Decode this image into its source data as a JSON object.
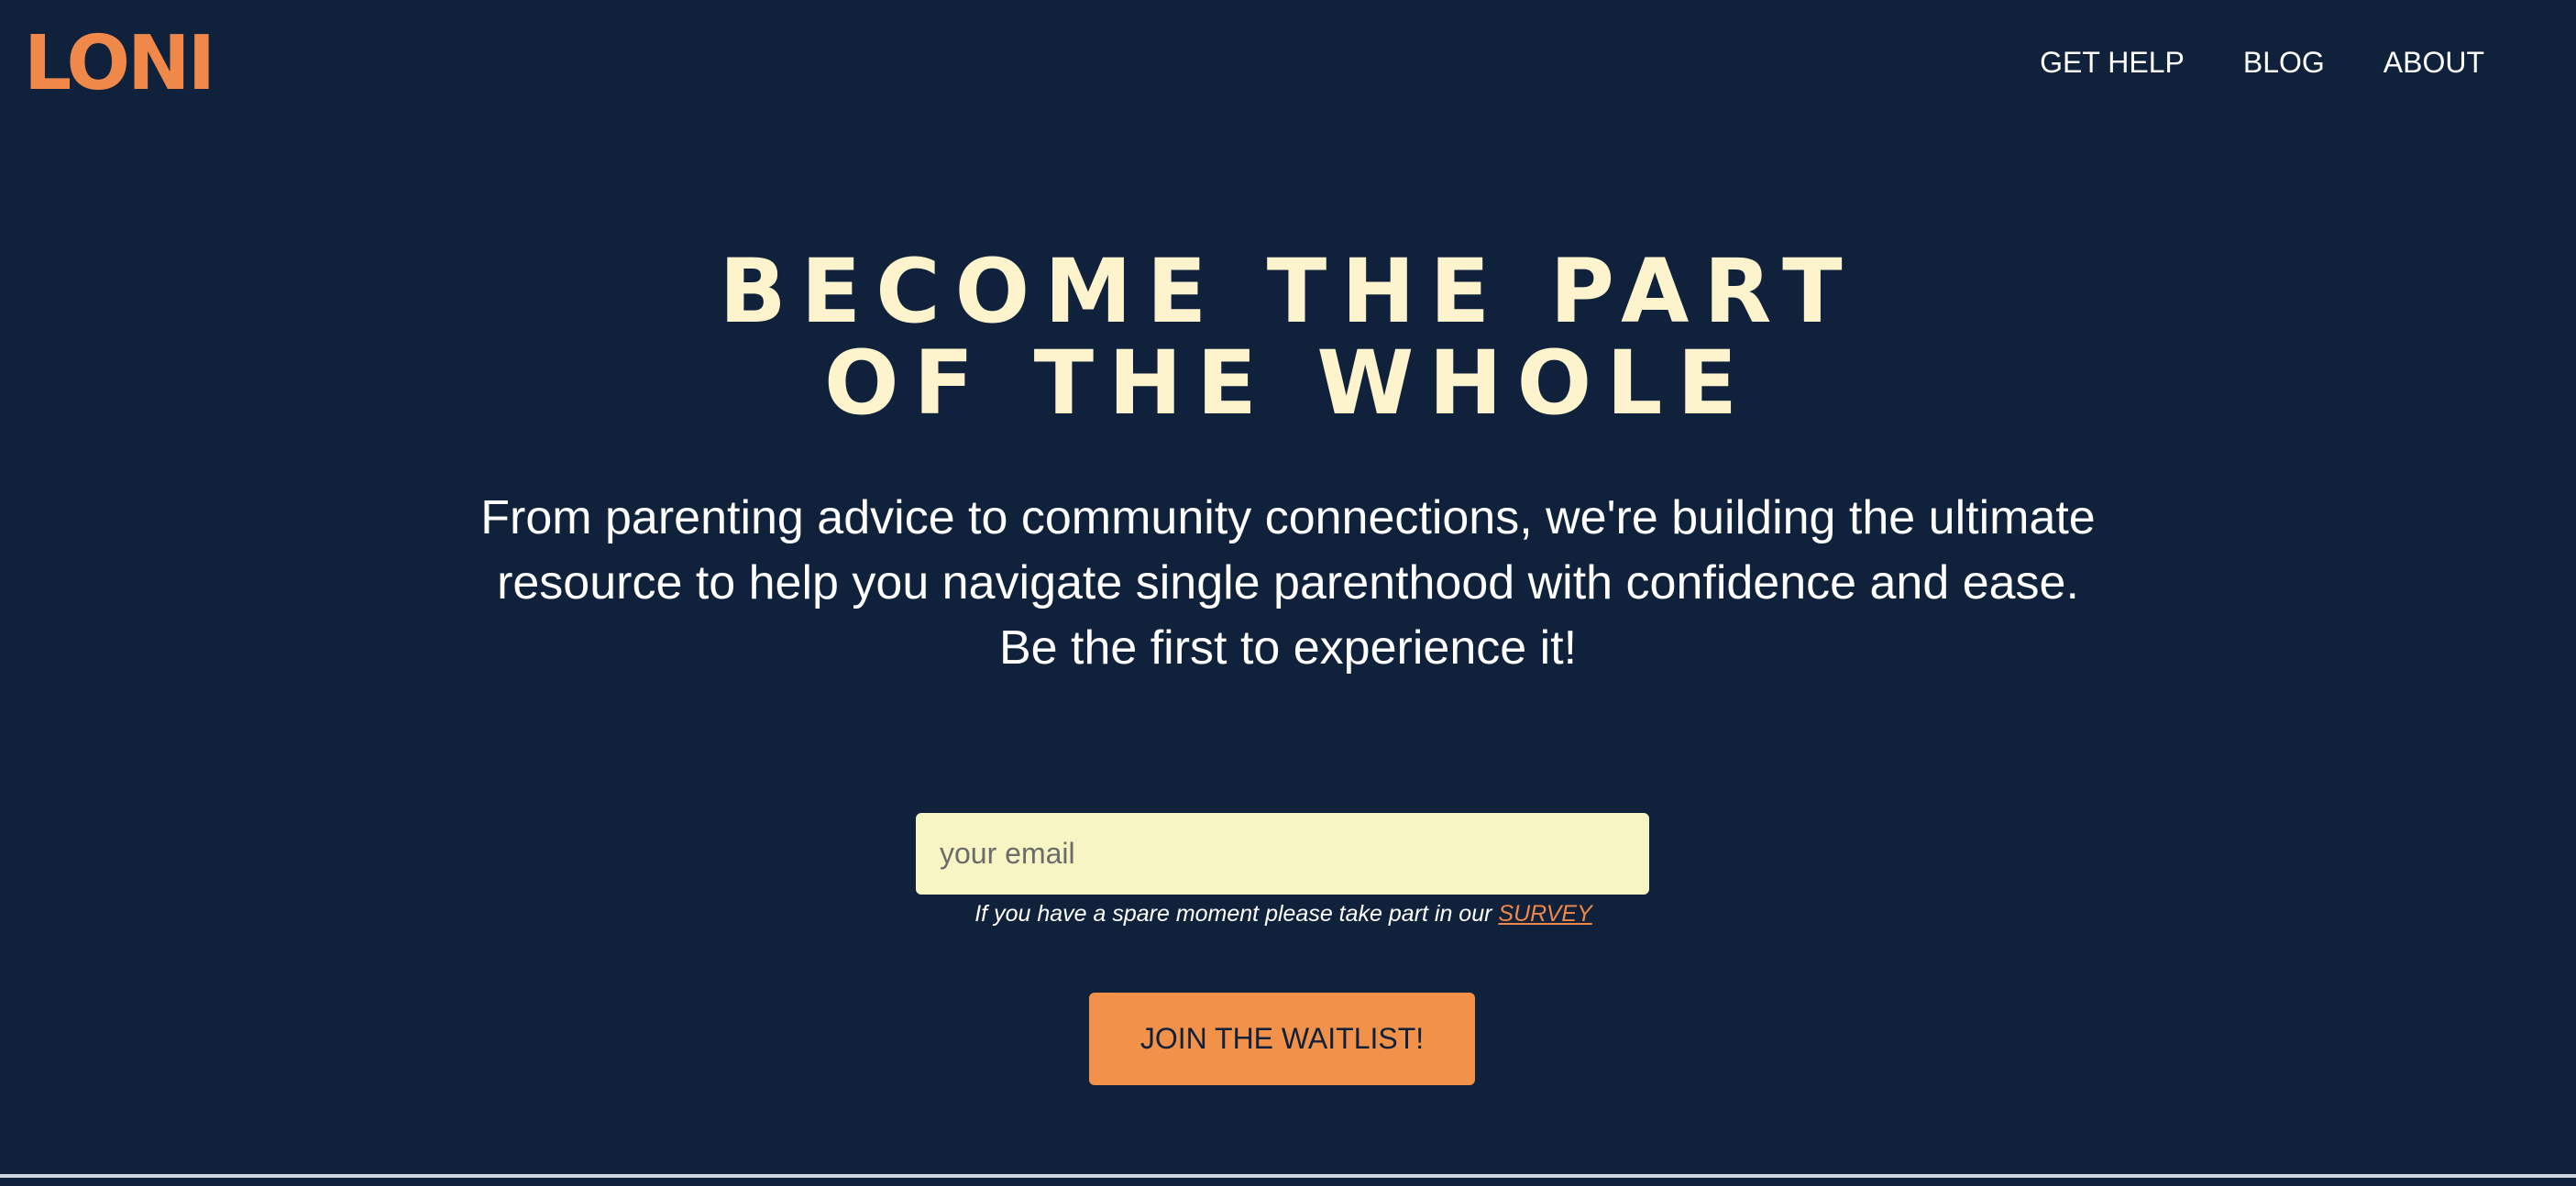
{
  "header": {
    "logo_text": "LONI",
    "nav": [
      {
        "label": "GET HELP"
      },
      {
        "label": "BLOG"
      },
      {
        "label": "ABOUT"
      }
    ]
  },
  "hero": {
    "title_line1": "BECOME THE PART",
    "title_line2": "OF THE WHOLE",
    "subtitle": "From parenting advice to community connections, we're building the ultimate resource to help you navigate single parenthood with confidence and ease. Be the first to experience it!"
  },
  "form": {
    "email_placeholder": "your email",
    "email_value": "",
    "survey_prefix": "If you have a spare moment please take part in our ",
    "survey_link": "SURVEY",
    "join_label": "JOIN THE WAITLIST!"
  },
  "colors": {
    "background": "#10213b",
    "accent": "#f0884a",
    "title": "#fdf3cc",
    "input_bg": "#f8f5c4",
    "button_bg": "#f29149"
  }
}
